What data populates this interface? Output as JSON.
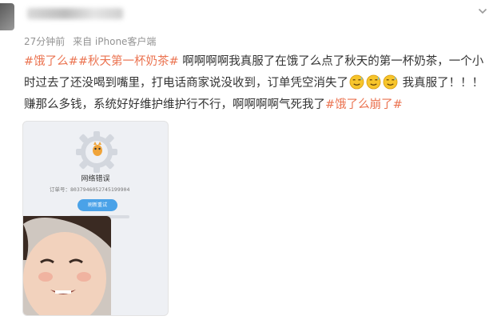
{
  "post": {
    "time": "27分钟前",
    "source": "来自 iPhone客户端",
    "tag_1": "#饿了么#",
    "tag_2": "#秋天第一杯奶茶#",
    "text_1": " 啊啊啊啊我真服了在饿了么点了秋天的第一杯奶茶，一个小时过去了还没喝到嘴里，打电话商家说没收到，订单凭空消失了",
    "text_2": " 我真服了！！！赚那么多钱，系统好好维护维护行不行，啊啊啊啊气死我了",
    "tag_3": "#饿了么崩了#",
    "emoji_icons": [
      "sweat-smile-emoji",
      "sweat-smile-emoji",
      "sweat-smile-emoji"
    ]
  },
  "image": {
    "error_title": "网络错误",
    "order_label": "订单号：8037946052745199904",
    "retry_label": "刷新重试"
  },
  "colors": {
    "tag": "#eb7350",
    "meta": "#939393",
    "retry": "#4aa2e8"
  }
}
